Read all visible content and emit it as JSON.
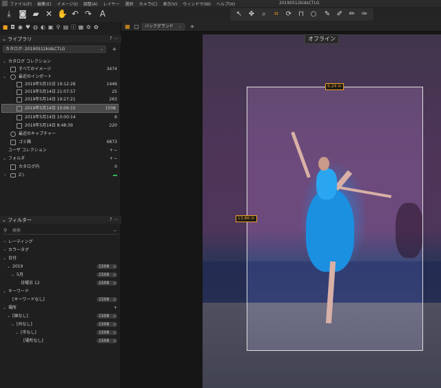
{
  "menu": {
    "items": [
      "ファイル(F)",
      "編集(E)",
      "イメージ(I)",
      "調整(A)",
      "レイヤー",
      "選択",
      "カメラ(C)",
      "表示(V)",
      "ウィンドウ(W)",
      "ヘルプ(H)"
    ],
    "window_title": "20190512kidsCTLG"
  },
  "library": {
    "title": "ライブラリ",
    "catalog_select": "カタログ: 20190512kidsCTLG",
    "catalog_collection": "カタログ コレクション",
    "all_images": {
      "label": "すべてのイメージ",
      "count": "3474"
    },
    "recent_imports": {
      "label": "最近のインポート",
      "items": [
        {
          "label": "2019年5月15日 19:12:28",
          "count": "1446"
        },
        {
          "label": "2019年5月14日 21:07:57",
          "count": "25"
        },
        {
          "label": "2019年5月14日 19:27:21",
          "count": "263"
        },
        {
          "label": "2019年5月14日 10:06:15",
          "count": "1508"
        },
        {
          "label": "2019年5月14日 10:00:14",
          "count": "6"
        },
        {
          "label": "2019年5月14日 8:48:39",
          "count": "220"
        }
      ]
    },
    "recent_captures": "最近のキャプチャー",
    "trash": {
      "label": "ゴミ箱",
      "count": "6873"
    },
    "user_collection": "ユーザ コレクション",
    "folders": "フォルダ",
    "catalog_folder": {
      "label": "カタログ内",
      "count": "0"
    },
    "drive": "Z:\\"
  },
  "filter": {
    "title": "フィルター",
    "search_placeholder": "検索",
    "rating": "レーティング",
    "color_tag": "カラータグ",
    "date": "日付",
    "year": {
      "label": "2019",
      "count": "1508"
    },
    "month": {
      "label": "5月",
      "count": "1508"
    },
    "day": {
      "label": "日曜日 12",
      "count": "1508"
    },
    "keyword": "キーワード",
    "no_keyword": {
      "label": "[キーワードなし]",
      "count": "1508"
    },
    "location": "場所",
    "no_country": {
      "label": "[国なし]",
      "count": "1508"
    },
    "no_state": {
      "label": "[州なし]",
      "count": "1508"
    },
    "no_city": {
      "label": "[市なし]",
      "count": "1508"
    },
    "no_place": {
      "label": "[場所なし]",
      "count": "1508"
    }
  },
  "viewer": {
    "background_select": "バックグランド",
    "offline_label": "オフライン",
    "crop_width": "9.24 in",
    "crop_height": "13.86 in"
  },
  "colors": {
    "accent": "#f0a020",
    "drive_status": "#2fbf5f"
  }
}
